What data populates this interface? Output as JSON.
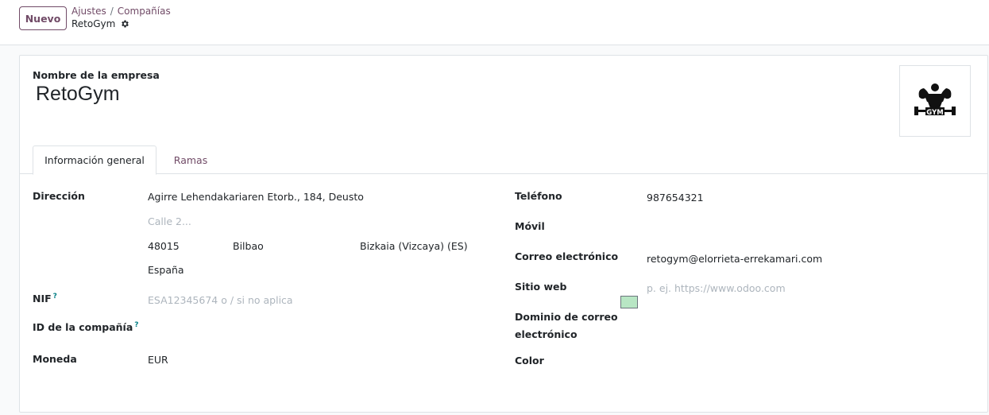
{
  "control_panel": {
    "new_button": "Nuevo",
    "breadcrumb": {
      "settings": "Ajustes",
      "separator": "/",
      "companies": "Compañías"
    },
    "record_name": "RetoGym",
    "record_icon": "gear-icon"
  },
  "form": {
    "company_label": "Nombre de la empresa",
    "company_name": "RetoGym",
    "logo_icon": "gym-logo",
    "tabs": [
      {
        "label": "Información general",
        "active": true
      },
      {
        "label": "Ramas",
        "active": false
      }
    ],
    "left": {
      "address_label": "Dirección",
      "street": "Agirre Lehendakariaren Etorb., 184, Deusto",
      "street2_placeholder": "Calle 2...",
      "zip": "48015",
      "city": "Bilbao",
      "state": "Bizkaia (Vizcaya) (ES)",
      "country": "España",
      "vat_label": "NIF",
      "vat_help": "?",
      "vat_placeholder": "ESA12345674 o / si no aplica",
      "company_id_label": "ID de la compañía",
      "company_id_help": "?",
      "currency_label": "Moneda",
      "currency": "EUR"
    },
    "right": {
      "phone_label": "Teléfono",
      "phone": "987654321",
      "mobile_label": "Móvil",
      "email_label": "Correo electrónico",
      "email": "retogym@elorrieta-errekamari.com",
      "website_label": "Sitio web",
      "website_placeholder": "p. ej. https://www.odoo.com",
      "email_domain_label_1": "Dominio de correo",
      "email_domain_label_2": "electrónico",
      "color_label": "Color",
      "color_value": "#b8e6c4"
    }
  },
  "colors": {
    "brand": "#714B67",
    "help": "#017e84"
  }
}
